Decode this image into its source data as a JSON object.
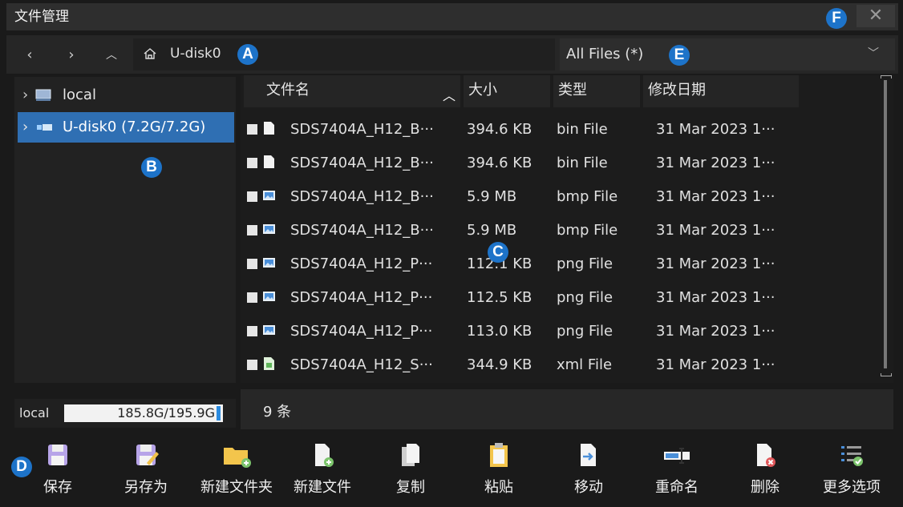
{
  "window": {
    "title": "文件管理",
    "close_glyph": "✕"
  },
  "nav": {
    "back": "‹",
    "forward": "›",
    "up": "︿",
    "path": "U-disk0"
  },
  "filter": {
    "value": "All Files (*)"
  },
  "badges": {
    "a": "A",
    "b": "B",
    "c": "C",
    "d": "D",
    "e": "E",
    "f": "F"
  },
  "tree": [
    {
      "label": "local",
      "icon": "drive-icon"
    },
    {
      "label": "U-disk0  (7.2G/7.2G)",
      "icon": "usb-drive-icon",
      "selected": true
    }
  ],
  "storage": {
    "label": "local",
    "value": "185.8G/195.9G",
    "used_fraction": 0.948
  },
  "columns": {
    "name": "文件名",
    "size": "大小",
    "type": "类型",
    "date": "修改日期"
  },
  "files": [
    {
      "name": "SDS7404A_H12_B···",
      "size": "394.6 KB",
      "type": "bin File",
      "date": "31 Mar 2023 1···",
      "icon": "document-icon"
    },
    {
      "name": "SDS7404A_H12_B···",
      "size": "394.6 KB",
      "type": "bin File",
      "date": "31 Mar 2023 1···",
      "icon": "document-icon"
    },
    {
      "name": "SDS7404A_H12_B···",
      "size": "5.9 MB",
      "type": "bmp File",
      "date": "31 Mar 2023 1···",
      "icon": "image-icon"
    },
    {
      "name": "SDS7404A_H12_B···",
      "size": "5.9 MB",
      "type": "bmp File",
      "date": "31 Mar 2023 1···",
      "icon": "image-icon"
    },
    {
      "name": "SDS7404A_H12_P···",
      "size": "112.1 KB",
      "type": "png File",
      "date": "31 Mar 2023 1···",
      "icon": "image-icon"
    },
    {
      "name": "SDS7404A_H12_P···",
      "size": "112.5 KB",
      "type": "png File",
      "date": "31 Mar 2023 1···",
      "icon": "image-icon"
    },
    {
      "name": "SDS7404A_H12_P···",
      "size": "113.0 KB",
      "type": "png File",
      "date": "31 Mar 2023 1···",
      "icon": "image-icon"
    },
    {
      "name": "SDS7404A_H12_S···",
      "size": "344.9 KB",
      "type": "xml File",
      "date": "31 Mar 2023 1···",
      "icon": "xml-file-icon"
    }
  ],
  "count": "9 条",
  "toolbar": {
    "save": "保存",
    "save_as": "另存为",
    "new_folder": "新建文件夹",
    "new_file": "新建文件",
    "copy": "复制",
    "paste": "粘贴",
    "move": "移动",
    "rename": "重命名",
    "delete": "删除",
    "more": "更多选项"
  },
  "colors": {
    "accent": "#1d73c9",
    "selection": "#2f6fb3"
  }
}
